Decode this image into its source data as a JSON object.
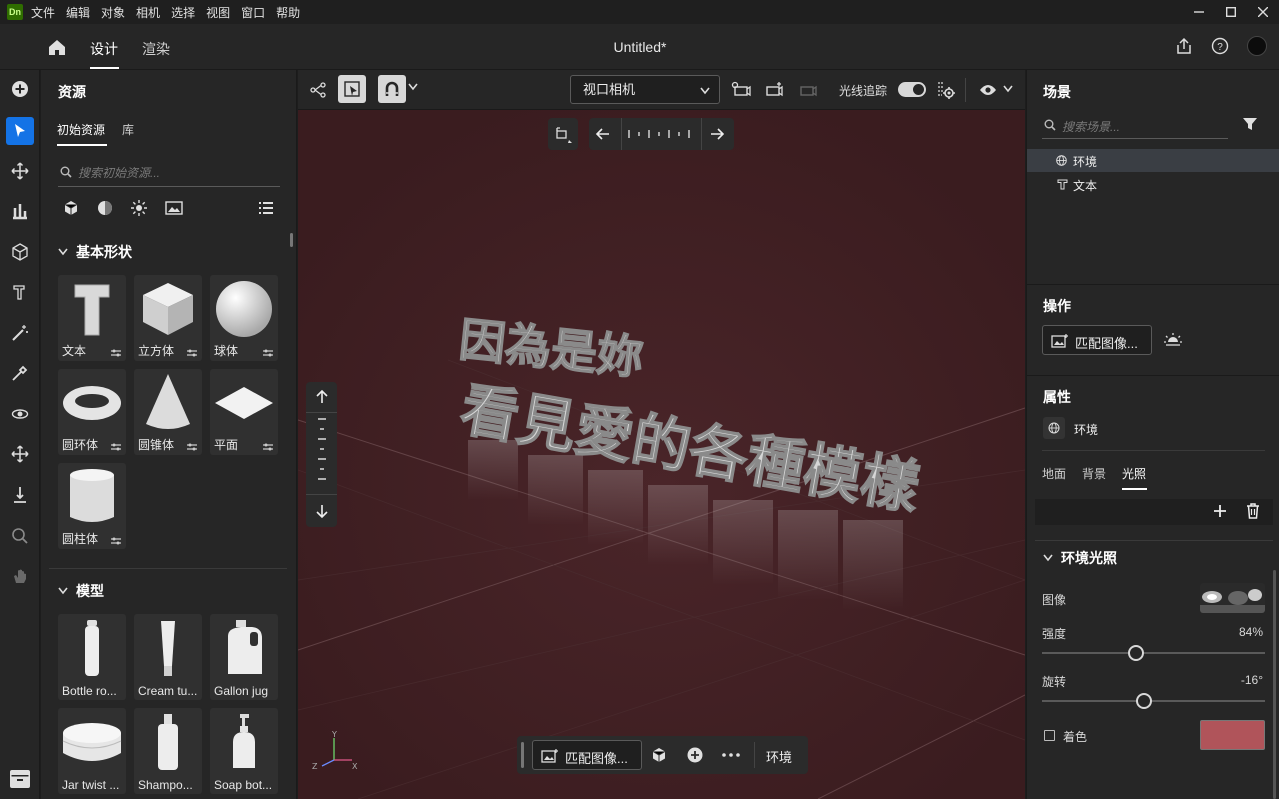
{
  "app": {
    "logo": "Dn",
    "menu": [
      "文件",
      "编辑",
      "对象",
      "相机",
      "选择",
      "视图",
      "窗口",
      "帮助"
    ]
  },
  "header": {
    "tabs": [
      "设计",
      "渲染"
    ],
    "doc_title": "Untitled*"
  },
  "assets": {
    "title": "资源",
    "subtabs": [
      "初始资源",
      "库"
    ],
    "search_placeholder": "搜索初始资源...",
    "basic_section": "基本形状",
    "basic_items": [
      "文本",
      "立方体",
      "球体",
      "圆环体",
      "圆锥体",
      "平面",
      "圆柱体"
    ],
    "models_section": "模型",
    "model_items": [
      "Bottle ro...",
      "Cream tu...",
      "Gallon jug",
      "Jar twist ...",
      "Shampo...",
      "Soap bot..."
    ]
  },
  "viewport": {
    "camera_select": "视口相机",
    "raytrace_label": "光线追踪",
    "raytrace_on": true,
    "scene_text_line1": "因為是妳",
    "scene_text_line2": "看見愛的各種模樣",
    "bottom_bar": {
      "match_image": "匹配图像...",
      "env": "环境"
    },
    "axes": {
      "x": "X",
      "y": "Y",
      "z": "Z"
    },
    "background_color": "#3e1f22"
  },
  "scene": {
    "title": "场景",
    "search_placeholder": "搜索场景...",
    "items": [
      "环境",
      "文本"
    ]
  },
  "actions": {
    "title": "操作",
    "match_image": "匹配图像..."
  },
  "properties": {
    "title": "属性",
    "object": "环境",
    "tabs": [
      "地面",
      "背景",
      "光照"
    ],
    "active_tab": "光照",
    "env_light_section": "环境光照",
    "image_label": "图像",
    "intensity_label": "强度",
    "intensity_value": "84%",
    "intensity": 0.84,
    "rotation_label": "旋转",
    "rotation_value": "-16°",
    "tint_label": "着色",
    "tint_color": "#b0545a"
  }
}
